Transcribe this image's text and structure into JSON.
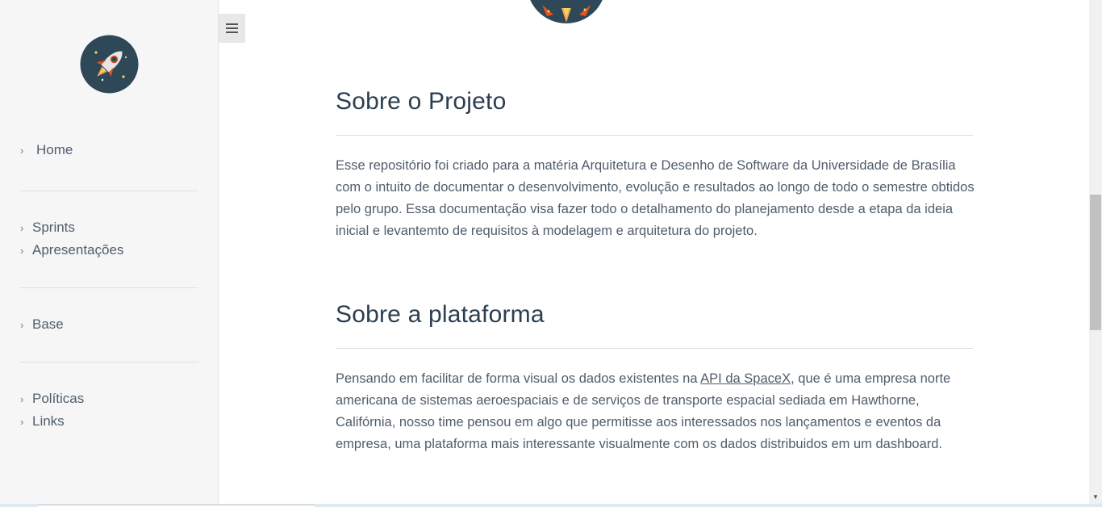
{
  "sidebar": {
    "groups": [
      {
        "items": [
          {
            "label": "Home"
          }
        ]
      },
      {
        "items": [
          {
            "label": "Sprints"
          },
          {
            "label": "Apresentações"
          }
        ]
      },
      {
        "items": [
          {
            "label": "Base"
          }
        ]
      },
      {
        "items": [
          {
            "label": "Políticas"
          },
          {
            "label": "Links"
          }
        ]
      }
    ],
    "chevron": "›",
    "logo_icon": "rocket-logo-icon"
  },
  "toolbar": {
    "menu_icon": "hamburger-menu-icon"
  },
  "main": {
    "sections": [
      {
        "title": "Sobre o Projeto",
        "body": "Esse repositório foi criado para a matéria Arquitetura e Desenho de Software da Universidade de Brasília com o intuito de documentar o desenvolvimento, evolução e resultados ao longo de todo o semestre obtidos pelo grupo. Essa documentação visa fazer todo o detalhamento do planejamento desde a etapa da ideia inicial e levantemto de requisitos à modelagem e arquitetura do projeto."
      },
      {
        "title": "Sobre a plataforma",
        "body_before": "Pensando em facilitar de forma visual os dados existentes na ",
        "link": "API da SpaceX",
        "body_after": ", que é uma empresa norte americana de sistemas aeroespaciais e de serviços de transporte espacial sediada em Hawthorne, Califórnia, nosso time pensou em algo que permitisse aos interessados nos lançamentos e eventos da empresa, uma plataforma mais interessante visualmente com os dados distribuidos em um dashboard."
      }
    ]
  },
  "colors": {
    "sidebar_bg": "#f6f6f6",
    "logo_bg": "#2f4858",
    "rocket_flame": "#e8531d",
    "text": "#505d6b"
  }
}
